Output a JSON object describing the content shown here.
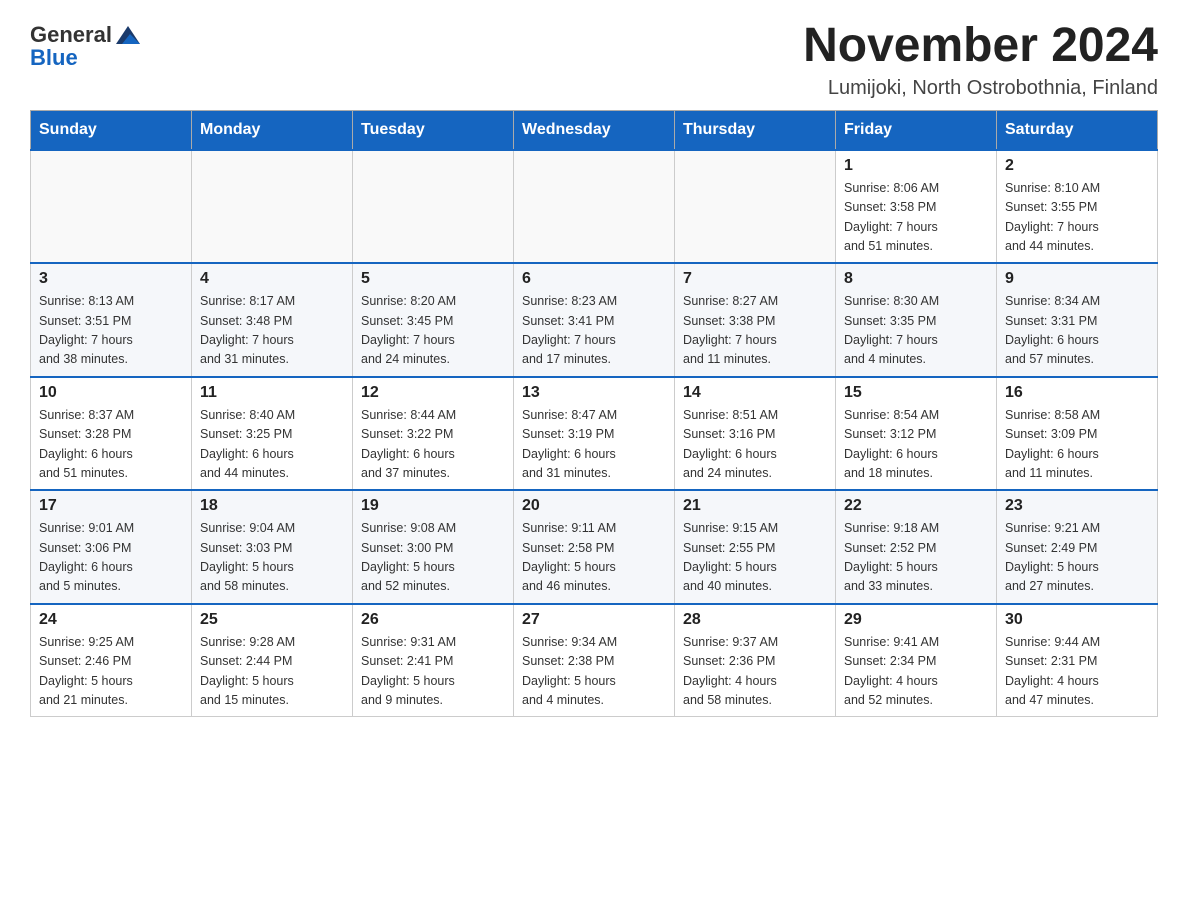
{
  "header": {
    "logo": {
      "text_general": "General",
      "text_blue": "Blue"
    },
    "title": "November 2024",
    "location": "Lumijoki, North Ostrobothnia, Finland"
  },
  "calendar": {
    "days_of_week": [
      "Sunday",
      "Monday",
      "Tuesday",
      "Wednesday",
      "Thursday",
      "Friday",
      "Saturday"
    ],
    "weeks": [
      [
        {
          "day": "",
          "info": ""
        },
        {
          "day": "",
          "info": ""
        },
        {
          "day": "",
          "info": ""
        },
        {
          "day": "",
          "info": ""
        },
        {
          "day": "",
          "info": ""
        },
        {
          "day": "1",
          "info": "Sunrise: 8:06 AM\nSunset: 3:58 PM\nDaylight: 7 hours\nand 51 minutes."
        },
        {
          "day": "2",
          "info": "Sunrise: 8:10 AM\nSunset: 3:55 PM\nDaylight: 7 hours\nand 44 minutes."
        }
      ],
      [
        {
          "day": "3",
          "info": "Sunrise: 8:13 AM\nSunset: 3:51 PM\nDaylight: 7 hours\nand 38 minutes."
        },
        {
          "day": "4",
          "info": "Sunrise: 8:17 AM\nSunset: 3:48 PM\nDaylight: 7 hours\nand 31 minutes."
        },
        {
          "day": "5",
          "info": "Sunrise: 8:20 AM\nSunset: 3:45 PM\nDaylight: 7 hours\nand 24 minutes."
        },
        {
          "day": "6",
          "info": "Sunrise: 8:23 AM\nSunset: 3:41 PM\nDaylight: 7 hours\nand 17 minutes."
        },
        {
          "day": "7",
          "info": "Sunrise: 8:27 AM\nSunset: 3:38 PM\nDaylight: 7 hours\nand 11 minutes."
        },
        {
          "day": "8",
          "info": "Sunrise: 8:30 AM\nSunset: 3:35 PM\nDaylight: 7 hours\nand 4 minutes."
        },
        {
          "day": "9",
          "info": "Sunrise: 8:34 AM\nSunset: 3:31 PM\nDaylight: 6 hours\nand 57 minutes."
        }
      ],
      [
        {
          "day": "10",
          "info": "Sunrise: 8:37 AM\nSunset: 3:28 PM\nDaylight: 6 hours\nand 51 minutes."
        },
        {
          "day": "11",
          "info": "Sunrise: 8:40 AM\nSunset: 3:25 PM\nDaylight: 6 hours\nand 44 minutes."
        },
        {
          "day": "12",
          "info": "Sunrise: 8:44 AM\nSunset: 3:22 PM\nDaylight: 6 hours\nand 37 minutes."
        },
        {
          "day": "13",
          "info": "Sunrise: 8:47 AM\nSunset: 3:19 PM\nDaylight: 6 hours\nand 31 minutes."
        },
        {
          "day": "14",
          "info": "Sunrise: 8:51 AM\nSunset: 3:16 PM\nDaylight: 6 hours\nand 24 minutes."
        },
        {
          "day": "15",
          "info": "Sunrise: 8:54 AM\nSunset: 3:12 PM\nDaylight: 6 hours\nand 18 minutes."
        },
        {
          "day": "16",
          "info": "Sunrise: 8:58 AM\nSunset: 3:09 PM\nDaylight: 6 hours\nand 11 minutes."
        }
      ],
      [
        {
          "day": "17",
          "info": "Sunrise: 9:01 AM\nSunset: 3:06 PM\nDaylight: 6 hours\nand 5 minutes."
        },
        {
          "day": "18",
          "info": "Sunrise: 9:04 AM\nSunset: 3:03 PM\nDaylight: 5 hours\nand 58 minutes."
        },
        {
          "day": "19",
          "info": "Sunrise: 9:08 AM\nSunset: 3:00 PM\nDaylight: 5 hours\nand 52 minutes."
        },
        {
          "day": "20",
          "info": "Sunrise: 9:11 AM\nSunset: 2:58 PM\nDaylight: 5 hours\nand 46 minutes."
        },
        {
          "day": "21",
          "info": "Sunrise: 9:15 AM\nSunset: 2:55 PM\nDaylight: 5 hours\nand 40 minutes."
        },
        {
          "day": "22",
          "info": "Sunrise: 9:18 AM\nSunset: 2:52 PM\nDaylight: 5 hours\nand 33 minutes."
        },
        {
          "day": "23",
          "info": "Sunrise: 9:21 AM\nSunset: 2:49 PM\nDaylight: 5 hours\nand 27 minutes."
        }
      ],
      [
        {
          "day": "24",
          "info": "Sunrise: 9:25 AM\nSunset: 2:46 PM\nDaylight: 5 hours\nand 21 minutes."
        },
        {
          "day": "25",
          "info": "Sunrise: 9:28 AM\nSunset: 2:44 PM\nDaylight: 5 hours\nand 15 minutes."
        },
        {
          "day": "26",
          "info": "Sunrise: 9:31 AM\nSunset: 2:41 PM\nDaylight: 5 hours\nand 9 minutes."
        },
        {
          "day": "27",
          "info": "Sunrise: 9:34 AM\nSunset: 2:38 PM\nDaylight: 5 hours\nand 4 minutes."
        },
        {
          "day": "28",
          "info": "Sunrise: 9:37 AM\nSunset: 2:36 PM\nDaylight: 4 hours\nand 58 minutes."
        },
        {
          "day": "29",
          "info": "Sunrise: 9:41 AM\nSunset: 2:34 PM\nDaylight: 4 hours\nand 52 minutes."
        },
        {
          "day": "30",
          "info": "Sunrise: 9:44 AM\nSunset: 2:31 PM\nDaylight: 4 hours\nand 47 minutes."
        }
      ]
    ]
  }
}
